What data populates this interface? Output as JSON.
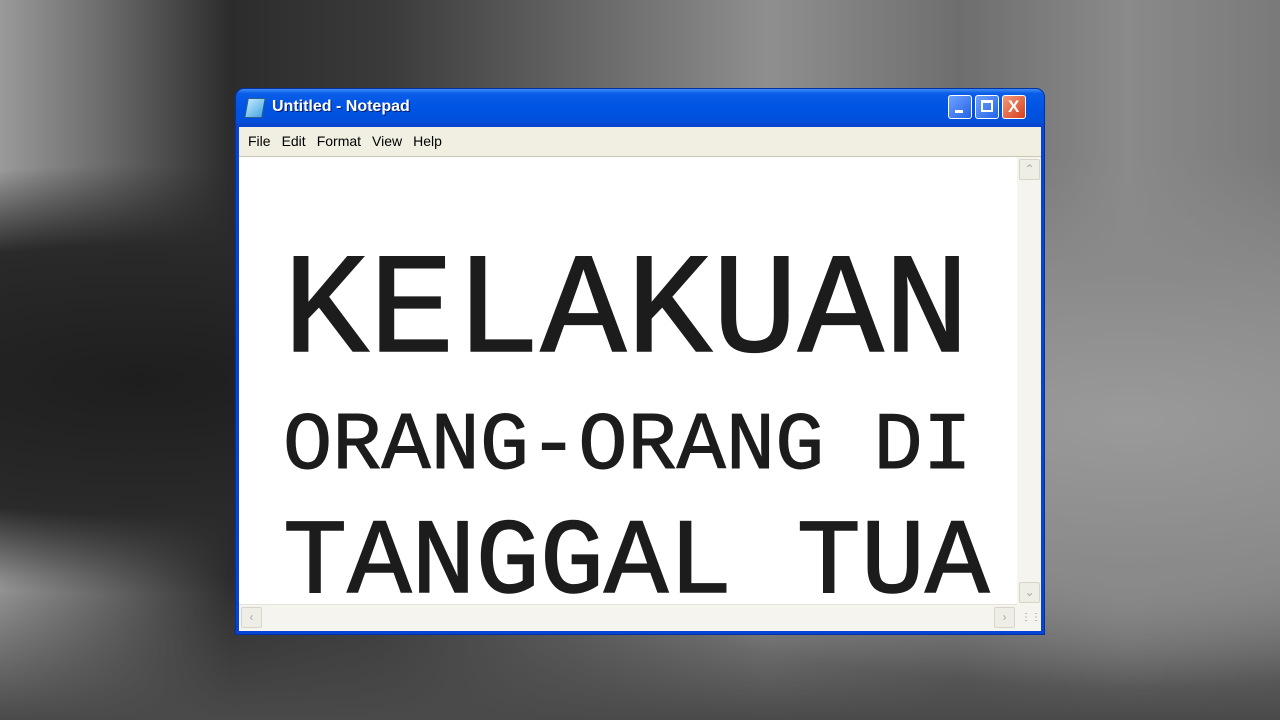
{
  "window": {
    "title": "Untitled - Notepad"
  },
  "menu": [
    "File",
    "Edit",
    "Format",
    "View",
    "Help"
  ],
  "document": {
    "lines": [
      "KELAKUAN",
      "ORANG-ORANG DI",
      "TANGGAL TUA"
    ]
  },
  "icons": {
    "app": "notepad-icon",
    "minimize": "minimize-icon",
    "maximize": "maximize-icon",
    "close": "close-icon"
  }
}
